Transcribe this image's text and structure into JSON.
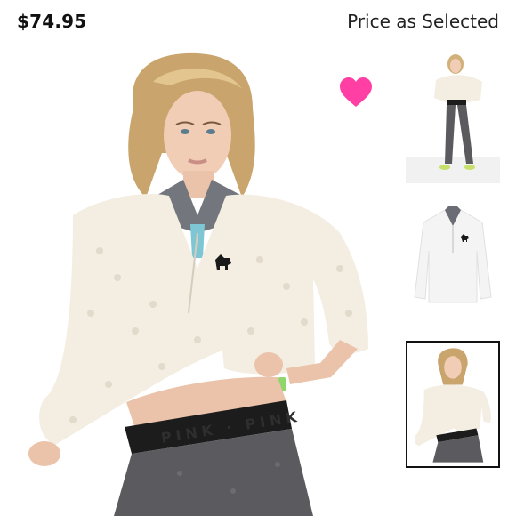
{
  "product": {
    "price": "$74.95",
    "price_note": "Price as Selected"
  },
  "icons": {
    "favorite": "heart-icon"
  },
  "colors": {
    "heart": "#ff3fa4",
    "sherpa": "#f3ede2",
    "leggings": "#5b5b5f",
    "waistband": "#1c1c1c",
    "selected_border": "#111111"
  },
  "waistband_text": "PINK",
  "thumbnails": {
    "selected_index": 2,
    "count": 3
  }
}
